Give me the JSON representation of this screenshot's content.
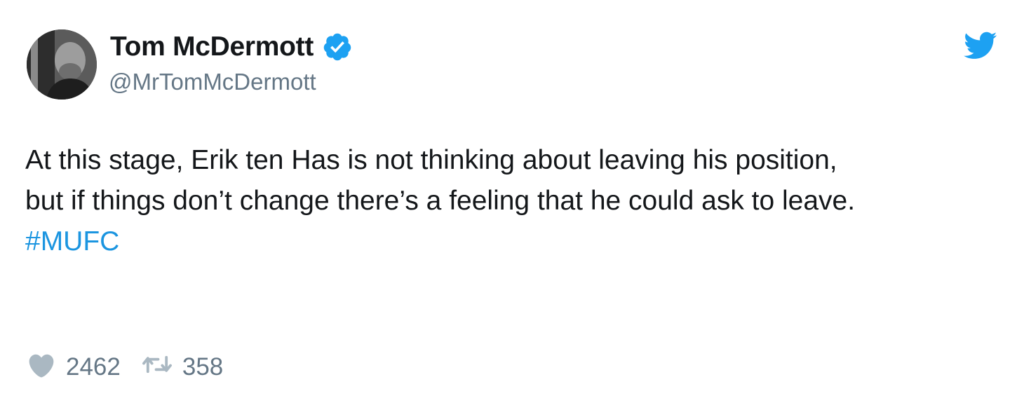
{
  "author": {
    "display_name": "Tom McDermott",
    "handle": "@MrTomMcDermott",
    "verified": true,
    "avatar_icon": "profile-photo"
  },
  "tweet": {
    "lines": [
      "At this stage, Erik ten Has is not thinking about leaving his position,",
      "but if things don’t change there’s a feeling that he could ask to leave."
    ],
    "hashtag": "#MUFC"
  },
  "stats": {
    "likes": "2462",
    "retweets": "358"
  },
  "icons": {
    "brand": "twitter-bird-icon",
    "verified": "verified-badge-icon",
    "like": "heart-icon",
    "retweet": "retweet-icon"
  },
  "colors": {
    "brand_blue": "#1da1f2",
    "hashtag_blue": "#1b95e0",
    "muted_gray": "#657786",
    "icon_gray": "#aab8c2",
    "text": "#14171a"
  }
}
